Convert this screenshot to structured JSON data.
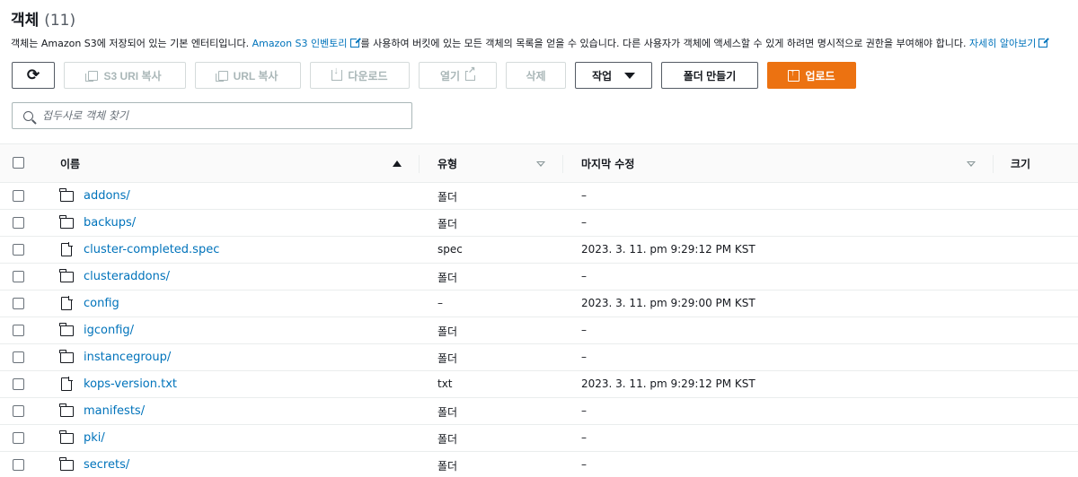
{
  "header": {
    "title": "객체",
    "count": "(11)"
  },
  "description": {
    "text1": "객체는 Amazon S3에 저장되어 있는 기본 엔터티입니다. ",
    "link1": "Amazon S3 인벤토리",
    "text2": "를 사용하여 버킷에 있는 모든 객체의 목록을 얻을 수 있습니다. 다른 사용자가 객체에 액세스할 수 있게 하려면 명시적으로 권한을 부여해야 합니다. ",
    "link2": "자세히 알아보기"
  },
  "toolbar": {
    "refresh_icon": "refresh-icon",
    "copy_s3_uri": "S3 URI 복사",
    "copy_url": "URL 복사",
    "download": "다운로드",
    "open": "열기",
    "delete": "삭제",
    "actions": "작업",
    "create_folder": "폴더 만들기",
    "upload": "업로드"
  },
  "search": {
    "placeholder": "접두사로 객체 찾기",
    "value": ""
  },
  "table": {
    "columns": {
      "name": "이름",
      "type": "유형",
      "modified": "마지막 수정",
      "size": "크기"
    },
    "rows": [
      {
        "icon": "folder",
        "name": "addons/",
        "type": "폴더",
        "modified": "–",
        "size": ""
      },
      {
        "icon": "folder",
        "name": "backups/",
        "type": "폴더",
        "modified": "–",
        "size": ""
      },
      {
        "icon": "file",
        "name": "cluster-completed.spec",
        "type": "spec",
        "modified": "2023. 3. 11. pm 9:29:12 PM KST",
        "size": ""
      },
      {
        "icon": "folder",
        "name": "clusteraddons/",
        "type": "폴더",
        "modified": "–",
        "size": ""
      },
      {
        "icon": "file",
        "name": "config",
        "type": "–",
        "modified": "2023. 3. 11. pm 9:29:00 PM KST",
        "size": ""
      },
      {
        "icon": "folder",
        "name": "igconfig/",
        "type": "폴더",
        "modified": "–",
        "size": ""
      },
      {
        "icon": "folder",
        "name": "instancegroup/",
        "type": "폴더",
        "modified": "–",
        "size": ""
      },
      {
        "icon": "file",
        "name": "kops-version.txt",
        "type": "txt",
        "modified": "2023. 3. 11. pm 9:29:12 PM KST",
        "size": ""
      },
      {
        "icon": "folder",
        "name": "manifests/",
        "type": "폴더",
        "modified": "–",
        "size": ""
      },
      {
        "icon": "folder",
        "name": "pki/",
        "type": "폴더",
        "modified": "–",
        "size": ""
      },
      {
        "icon": "folder",
        "name": "secrets/",
        "type": "폴더",
        "modified": "–",
        "size": ""
      }
    ]
  },
  "colors": {
    "link": "#0073bb",
    "primary": "#ec7211",
    "disabled": "#aab7b8"
  }
}
